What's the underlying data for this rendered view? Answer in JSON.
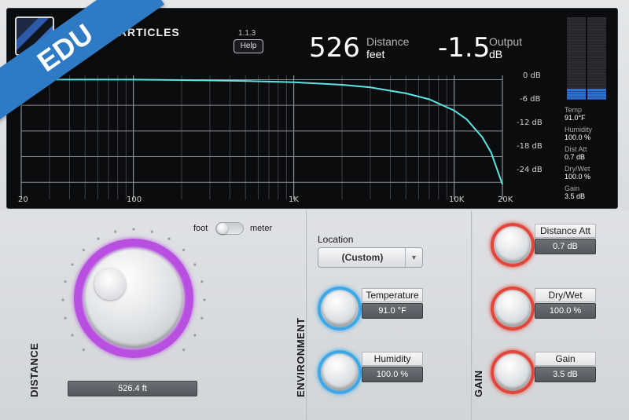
{
  "badge": {
    "text": "EDU"
  },
  "header": {
    "brand": "SOUND PARTICLES",
    "version": "1.1.3",
    "help_label": "Help",
    "distance_value": "526",
    "distance_label": "Distance",
    "distance_unit": "feet",
    "output_value": "-1.5",
    "output_label": "Output",
    "output_unit": "dB"
  },
  "graph": {
    "db_labels": [
      "0 dB",
      "-6 dB",
      "-12 dB",
      "-18 dB",
      "-24 dB"
    ],
    "freq_labels": [
      "20",
      "100",
      "1K",
      "10K",
      "20K"
    ],
    "curve_color": "#5fe3e3"
  },
  "chart_data": {
    "type": "line",
    "xlabel": "",
    "ylabel": "",
    "x_scale": "log",
    "xlim": [
      20,
      20000
    ],
    "ylim": [
      -28,
      1
    ],
    "series": [
      {
        "x": [
          20,
          50,
          100,
          200,
          500,
          1000,
          2000,
          3000,
          5000,
          7000,
          10000,
          12000,
          15000,
          17000,
          20000
        ],
        "y": [
          0,
          0,
          0,
          -0.1,
          -0.3,
          -0.6,
          -1.2,
          -1.8,
          -3.2,
          -4.6,
          -7.2,
          -9.3,
          -13.5,
          -17.0,
          -24.5
        ]
      }
    ]
  },
  "stats": [
    {
      "label": "Temp",
      "value": "91.0°F"
    },
    {
      "label": "Humidity",
      "value": "100.0 %"
    },
    {
      "label": "Dist Att",
      "value": "0.7 dB"
    },
    {
      "label": "Dry/Wet",
      "value": "100.0 %"
    },
    {
      "label": "Gain",
      "value": "3.5 dB"
    }
  ],
  "meters": {
    "level_fraction": 0.14,
    "color": "#2f6fd0"
  },
  "distance_panel": {
    "title": "DISTANCE",
    "toggle_left": "foot",
    "toggle_right": "meter",
    "knob_value": "526.4 ft",
    "ring_color": "#b84fe0"
  },
  "environment_panel": {
    "title": "ENVIRONMENT",
    "location_label": "Location",
    "location_value": "(Custom)",
    "temperature_label": "Temperature",
    "temperature_value": "91.0 °F",
    "humidity_label": "Humidity",
    "humidity_value": "100.0 %",
    "ring_color": "#3ea8e6"
  },
  "gain_panel": {
    "title": "GAIN",
    "distance_att_label": "Distance Att",
    "distance_att_value": "0.7 dB",
    "dry_wet_label": "Dry/Wet",
    "dry_wet_value": "100.0 %",
    "gain_label": "Gain",
    "gain_value": "3.5 dB",
    "ring_color": "#e2463a"
  }
}
